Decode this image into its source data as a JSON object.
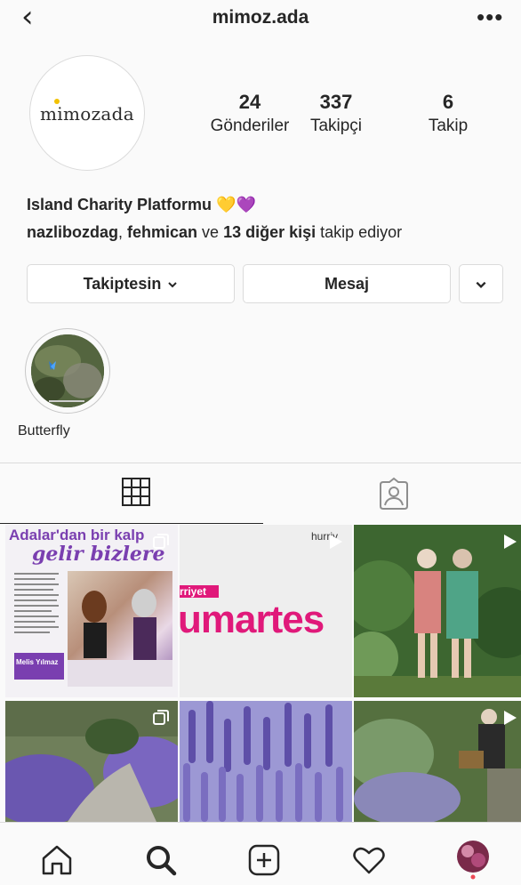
{
  "header": {
    "back_icon": "chevron-left-icon",
    "username": "mimoz.ada",
    "more_icon": "more-horizontal-icon"
  },
  "profile": {
    "logo_text": "mimozada",
    "stats": [
      {
        "value": "24",
        "label": "Gönderiler"
      },
      {
        "value": "337",
        "label": "Takipçi"
      },
      {
        "value": "6",
        "label": "Takip"
      }
    ],
    "bio_name": "Island Charity Platformu",
    "bio_emojis": "💛💜",
    "followed_by": {
      "user1": "nazlibozdag",
      "sep": ", ",
      "user2": "fehmican",
      "and": " ve ",
      "others": "13 diğer kişi",
      "suffix": " takip ediyor"
    }
  },
  "buttons": {
    "following": "Takiptesin",
    "message": "Mesaj",
    "chevron_icon": "chevron-down-icon"
  },
  "highlight": {
    "label": "Butterfly"
  },
  "tabs": {
    "grid_icon": "grid-icon",
    "tagged_icon": "tagged-person-icon"
  },
  "posts": [
    {
      "type": "carousel",
      "headline": "Adalar'dan bir kalp",
      "subline": "gelir bizlere",
      "byline": "Melis Yılmaz"
    },
    {
      "type": "video",
      "top_text": "hurriy",
      "big_text": "umartes",
      "brand": "rriyet"
    },
    {
      "type": "video"
    },
    {
      "type": "carousel"
    },
    {
      "type": "image"
    },
    {
      "type": "video"
    }
  ],
  "nav": {
    "home_icon": "home-icon",
    "search_icon": "search-icon",
    "add_icon": "add-post-icon",
    "activity_icon": "heart-icon",
    "profile_icon": "profile-avatar-icon"
  },
  "colors": {
    "text": "#262626",
    "border": "#dbdbdb",
    "accent_purple": "#7a3fb0",
    "accent_pink": "#e0197a",
    "notification_dot": "#ed4956"
  }
}
